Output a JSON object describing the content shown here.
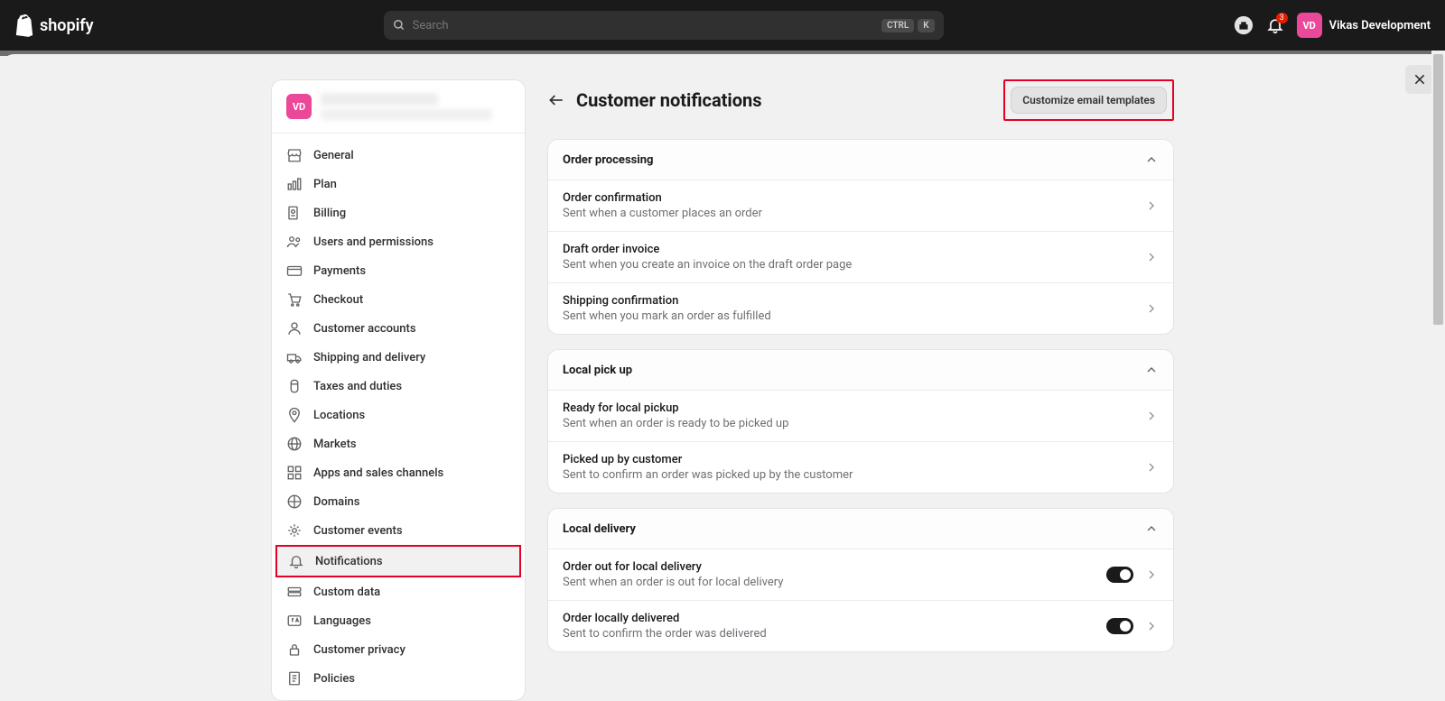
{
  "topbar": {
    "brand": "shopify",
    "search_placeholder": "Search",
    "search_kbd1": "CTRL",
    "search_kbd2": "K",
    "notification_count": "3",
    "user_initials": "VD",
    "user_name": "Vikas Development"
  },
  "sidebar": {
    "avatar_initials": "VD",
    "items": [
      {
        "label": "General",
        "icon": "store"
      },
      {
        "label": "Plan",
        "icon": "plan"
      },
      {
        "label": "Billing",
        "icon": "billing"
      },
      {
        "label": "Users and permissions",
        "icon": "users"
      },
      {
        "label": "Payments",
        "icon": "payments"
      },
      {
        "label": "Checkout",
        "icon": "checkout"
      },
      {
        "label": "Customer accounts",
        "icon": "person"
      },
      {
        "label": "Shipping and delivery",
        "icon": "shipping"
      },
      {
        "label": "Taxes and duties",
        "icon": "taxes"
      },
      {
        "label": "Locations",
        "icon": "locations"
      },
      {
        "label": "Markets",
        "icon": "markets"
      },
      {
        "label": "Apps and sales channels",
        "icon": "apps"
      },
      {
        "label": "Domains",
        "icon": "domains"
      },
      {
        "label": "Customer events",
        "icon": "events"
      },
      {
        "label": "Notifications",
        "icon": "bell"
      },
      {
        "label": "Custom data",
        "icon": "data"
      },
      {
        "label": "Languages",
        "icon": "languages"
      },
      {
        "label": "Customer privacy",
        "icon": "privacy"
      },
      {
        "label": "Policies",
        "icon": "policies"
      }
    ]
  },
  "main": {
    "title": "Customer notifications",
    "cta": "Customize email templates",
    "sections": [
      {
        "title": "Order processing",
        "rows": [
          {
            "title": "Order confirmation",
            "sub": "Sent when a customer places an order",
            "toggle": false
          },
          {
            "title": "Draft order invoice",
            "sub": "Sent when you create an invoice on the draft order page",
            "toggle": false
          },
          {
            "title": "Shipping confirmation",
            "sub": "Sent when you mark an order as fulfilled",
            "toggle": false
          }
        ]
      },
      {
        "title": "Local pick up",
        "rows": [
          {
            "title": "Ready for local pickup",
            "sub": "Sent when an order is ready to be picked up",
            "toggle": false
          },
          {
            "title": "Picked up by customer",
            "sub": "Sent to confirm an order was picked up by the customer",
            "toggle": false
          }
        ]
      },
      {
        "title": "Local delivery",
        "rows": [
          {
            "title": "Order out for local delivery",
            "sub": "Sent when an order is out for local delivery",
            "toggle": true
          },
          {
            "title": "Order locally delivered",
            "sub": "Sent to confirm the order was delivered",
            "toggle": true
          }
        ]
      }
    ]
  }
}
